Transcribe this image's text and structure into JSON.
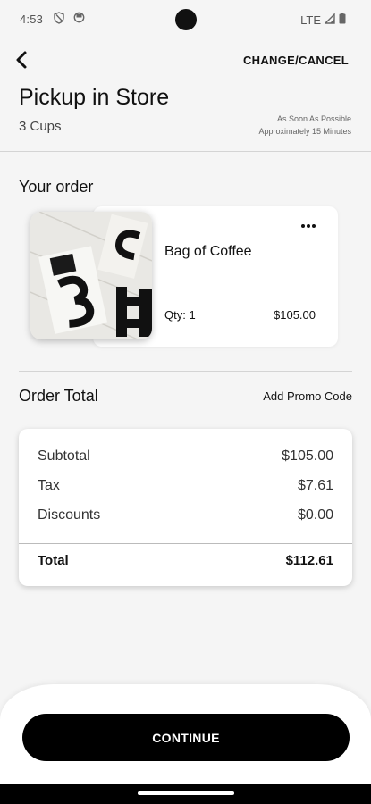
{
  "status_bar": {
    "time": "4:53",
    "network": "LTE",
    "left_icons": [
      "shield-icon",
      "sync-icon"
    ],
    "right_icons": [
      "signal-icon",
      "battery-icon"
    ]
  },
  "header": {
    "back_icon": "chevron-left-icon",
    "action_label": "CHANGE/CANCEL"
  },
  "page": {
    "title": "Pickup in Store",
    "subtitle": "3 Cups",
    "timing_line1": "As Soon As Possible",
    "timing_line2": "Approximately 15 Minutes"
  },
  "order": {
    "section_title": "Your order",
    "item": {
      "name": "Bag of Coffee",
      "qty_label": "Qty: 1",
      "price": "$105.00",
      "more_icon": "more-horizontal-icon"
    }
  },
  "totals": {
    "section_title": "Order Total",
    "promo_label": "Add Promo Code",
    "rows": [
      {
        "label": "Subtotal",
        "value": "$105.00"
      },
      {
        "label": "Tax",
        "value": "$7.61"
      },
      {
        "label": "Discounts",
        "value": "$0.00"
      }
    ],
    "total_label": "Total",
    "total_value": "$112.61"
  },
  "footer": {
    "continue_label": "CONTINUE"
  },
  "colors": {
    "background": "#f5f5f5",
    "card": "#ffffff",
    "primary_button": "#000000",
    "text": "#111111"
  }
}
